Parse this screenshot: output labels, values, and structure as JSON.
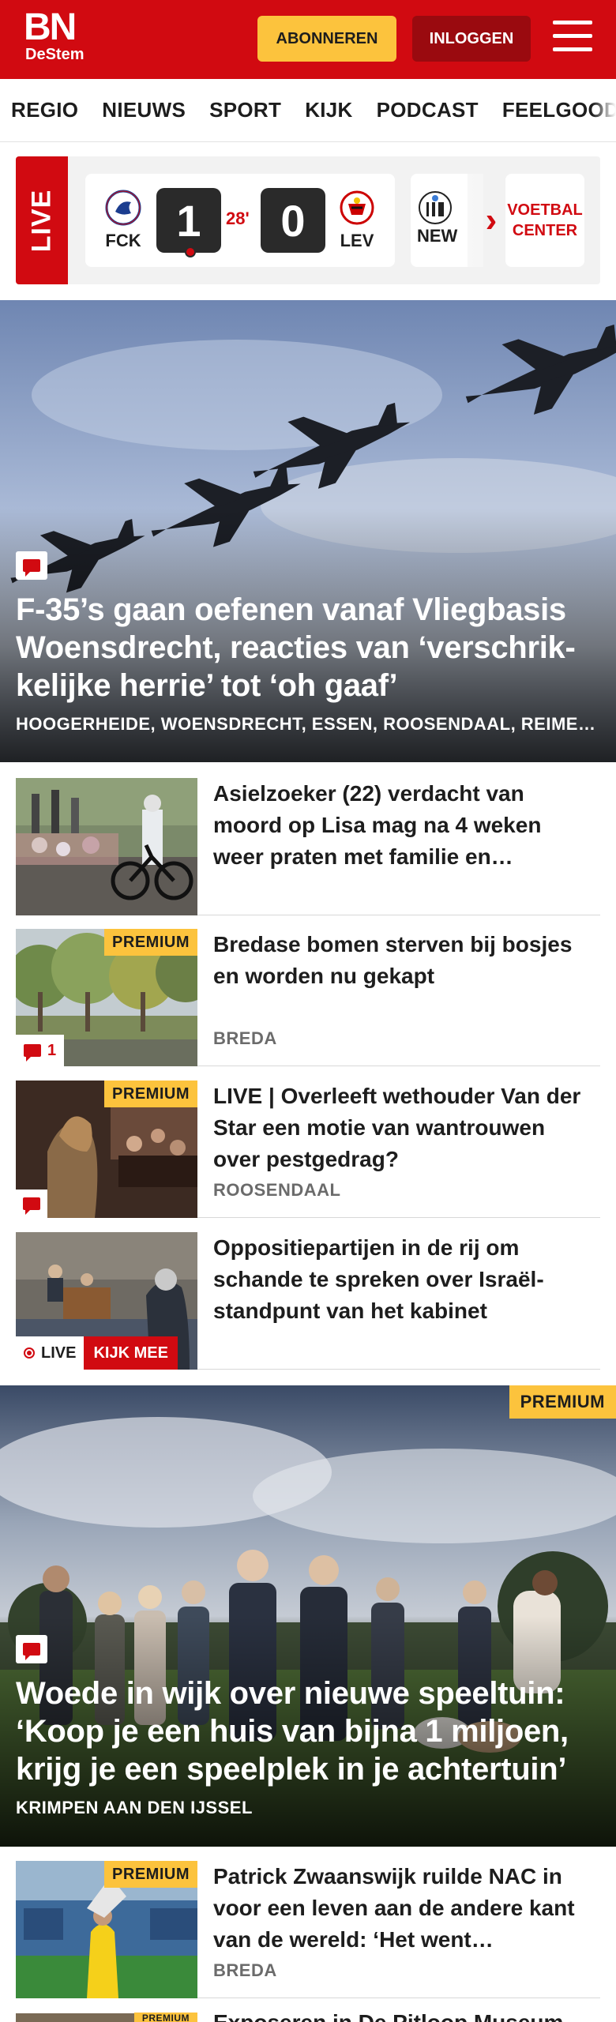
{
  "header": {
    "logo_main": "BN",
    "logo_sub": "DeStem",
    "subscribe_label": "ABONNEREN",
    "login_label": "INLOGGEN"
  },
  "nav": {
    "items": [
      "REGIO",
      "NIEUWS",
      "SPORT",
      "KIJK",
      "PODCAST",
      "FEELGOOD"
    ]
  },
  "scorebar": {
    "live_label": "LIVE",
    "match": {
      "home": "FCK",
      "away": "LEV",
      "home_score": "1",
      "away_score": "0",
      "minute": "28'"
    },
    "next_team": "NEW",
    "voetbal_center_line1": "VOETBAL",
    "voetbal_center_line2": "CENTER"
  },
  "hero1": {
    "headline": "F-35’s gaan oefenen vanaf Vliegbasis Woensdrecht, reacties van ‘verschrik­kelijke herrie’ tot ‘oh gaaf’",
    "location": "HOOGERHEIDE, WOENSDRECHT, ESSEN, ROOSENDAAL, REIMERSWAAL"
  },
  "articles": [
    {
      "title": "Asielzoeker (22) verdacht van moord op Lisa mag na 4 weken weer praten met familie en…",
      "location": "",
      "premium": false,
      "comments": ""
    },
    {
      "title": "Bredase bomen sterven bij bosjes en worden nu gekapt",
      "location": "BREDA",
      "premium": true,
      "premium_label": "PREMIUM",
      "comments": "1"
    },
    {
      "title": "LIVE | Overleeft wethouder Van der Star een motie van wantrouwen over pestgedrag?",
      "location": "ROOSENDAAL",
      "premium": true,
      "premium_label": "PREMIUM",
      "comments": ""
    },
    {
      "title": "Oppositiepartijen in de rij om schande te spreken over Israël-standpunt van het kabinet",
      "location": "",
      "premium": false,
      "live_label": "LIVE",
      "watch_label": "KIJK MEE"
    }
  ],
  "hero2": {
    "premium_label": "PREMIUM",
    "headline": "Woede in wijk over nieuwe speeltuin: ‘Koop je een huis van bijna 1 miljoen, krijg je een speelplek in je achtertuin’",
    "location": "KRIMPEN AAN DEN IJSSEL"
  },
  "article5": {
    "title": "Patrick Zwaanswijk ruilde NAC in voor een leven aan de andere kant van de wereld: ‘Het went…",
    "location": "BREDA",
    "premium_label": "PREMIUM"
  },
  "article6": {
    "premium_label": "PREMIUM",
    "title": "Exposeren in De Pitloop Museum"
  },
  "colors": {
    "brand_red": "#d10a11",
    "premium_yellow": "#fcc33d"
  }
}
